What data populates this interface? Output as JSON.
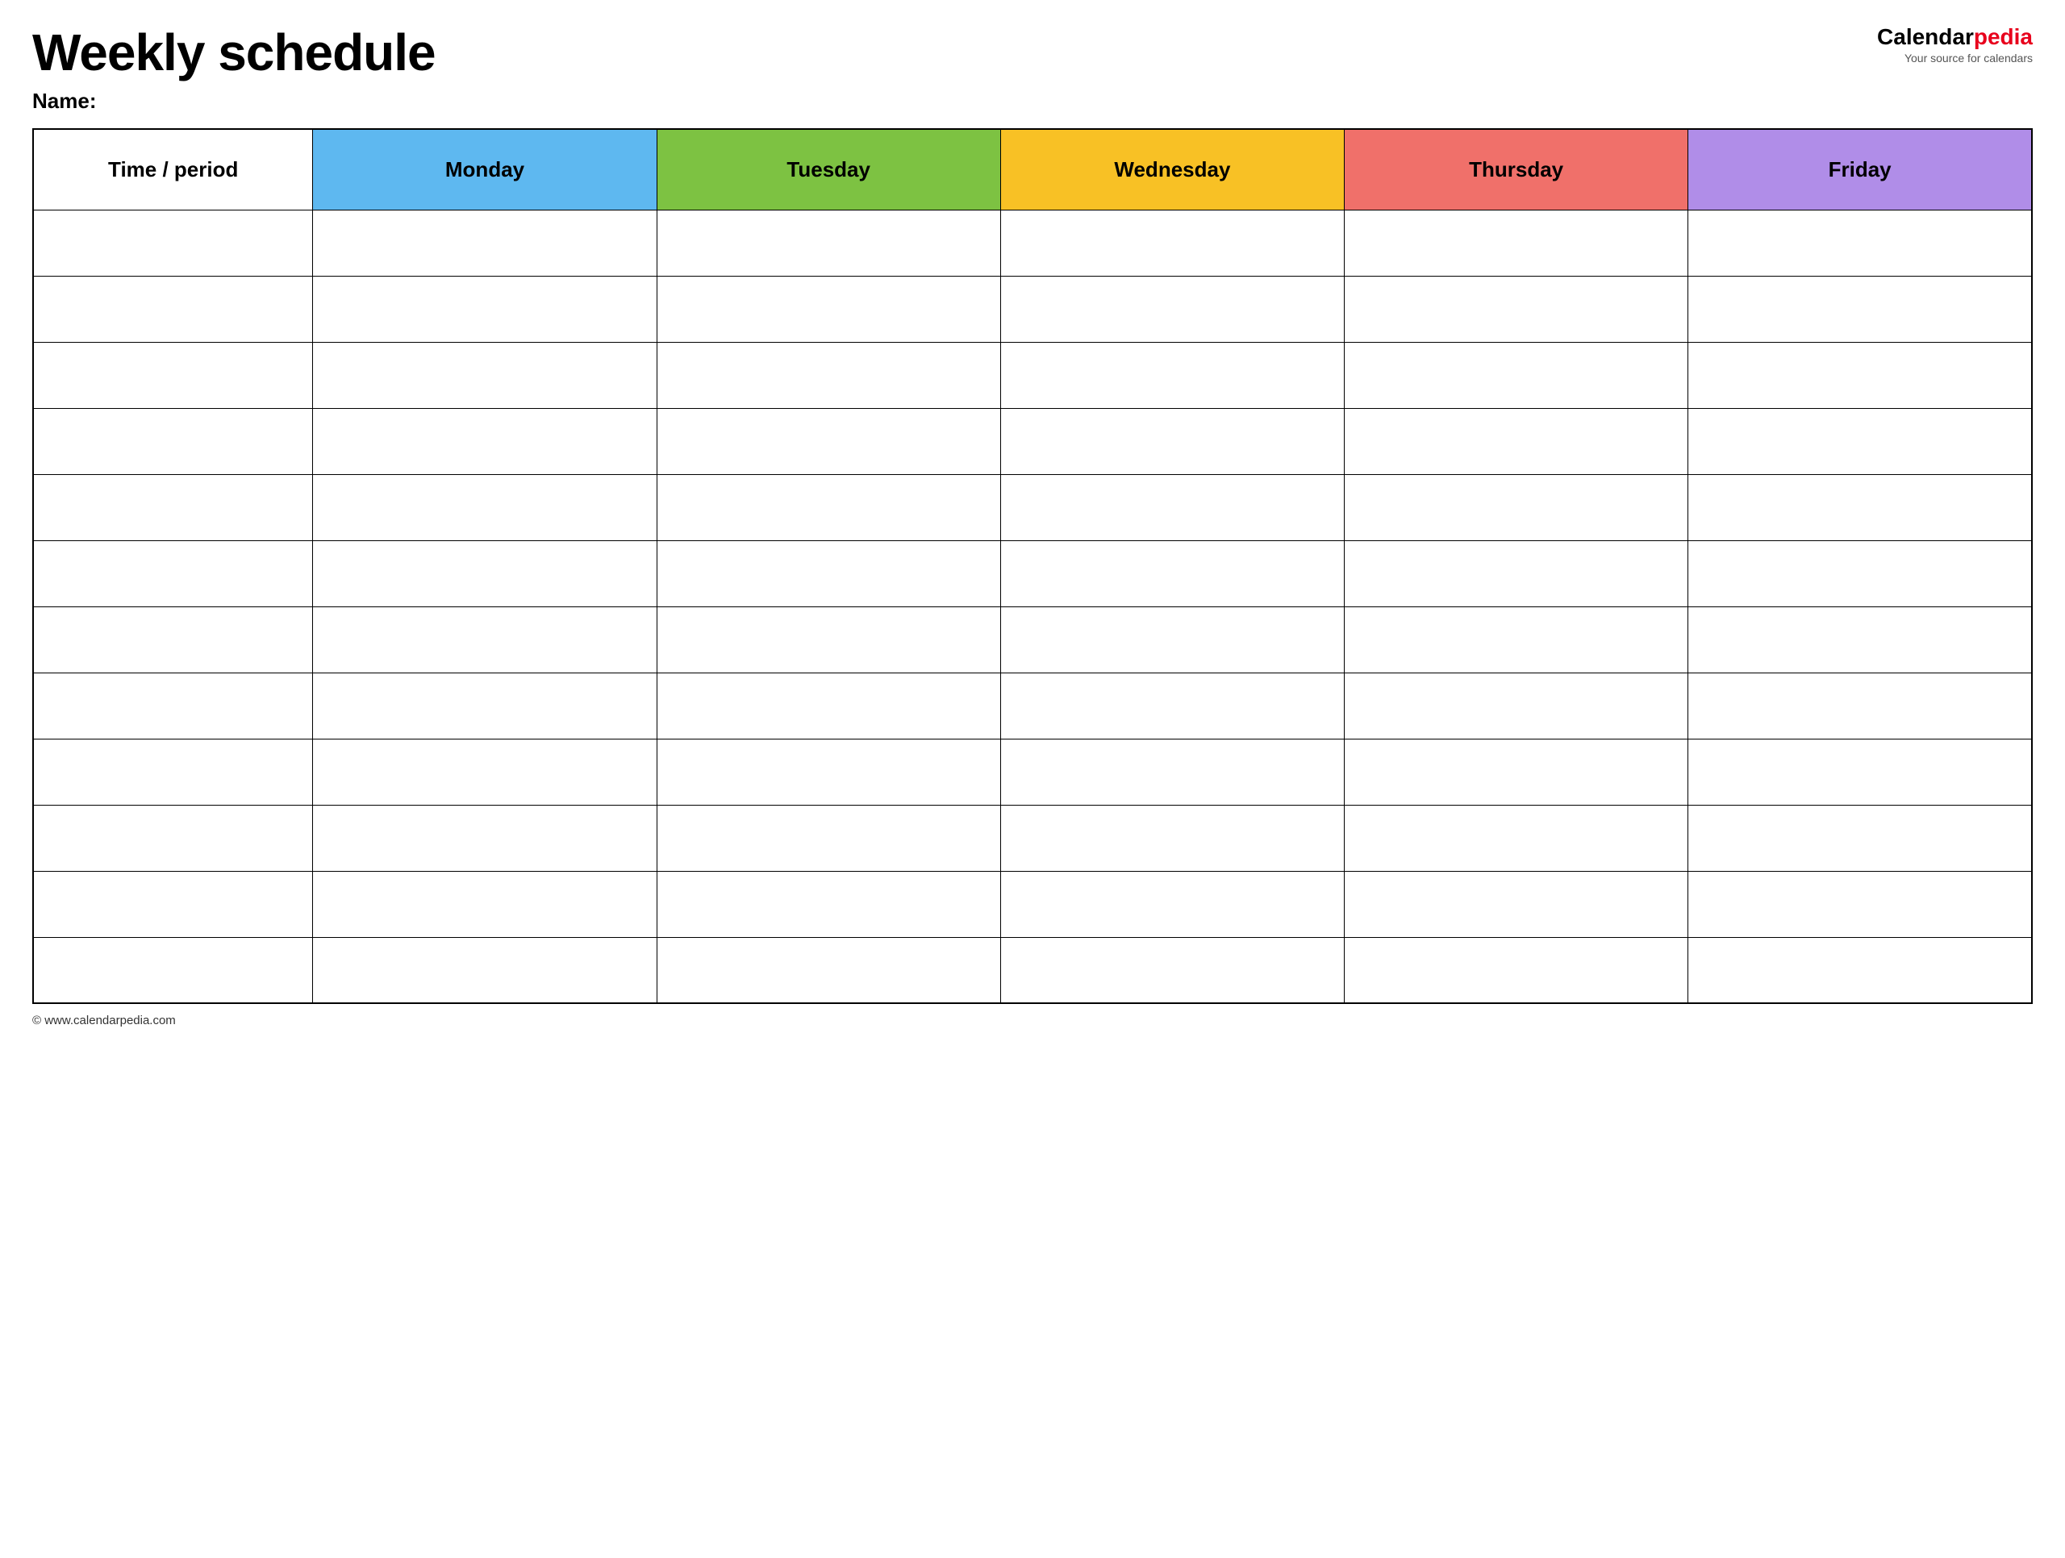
{
  "header": {
    "main_title": "Weekly schedule",
    "name_label": "Name:",
    "logo_text_calendar": "Calendar",
    "logo_text_pedia": "pedia",
    "logo_tagline": "Your source for calendars"
  },
  "table": {
    "headers": [
      {
        "id": "time",
        "label": "Time / period",
        "color_class": "col-time-header"
      },
      {
        "id": "monday",
        "label": "Monday",
        "color_class": "col-monday"
      },
      {
        "id": "tuesday",
        "label": "Tuesday",
        "color_class": "col-tuesday"
      },
      {
        "id": "wednesday",
        "label": "Wednesday",
        "color_class": "col-wednesday"
      },
      {
        "id": "thursday",
        "label": "Thursday",
        "color_class": "col-thursday"
      },
      {
        "id": "friday",
        "label": "Friday",
        "color_class": "col-friday"
      }
    ],
    "row_count": 12
  },
  "footer": {
    "url": "© www.calendarpedia.com"
  }
}
